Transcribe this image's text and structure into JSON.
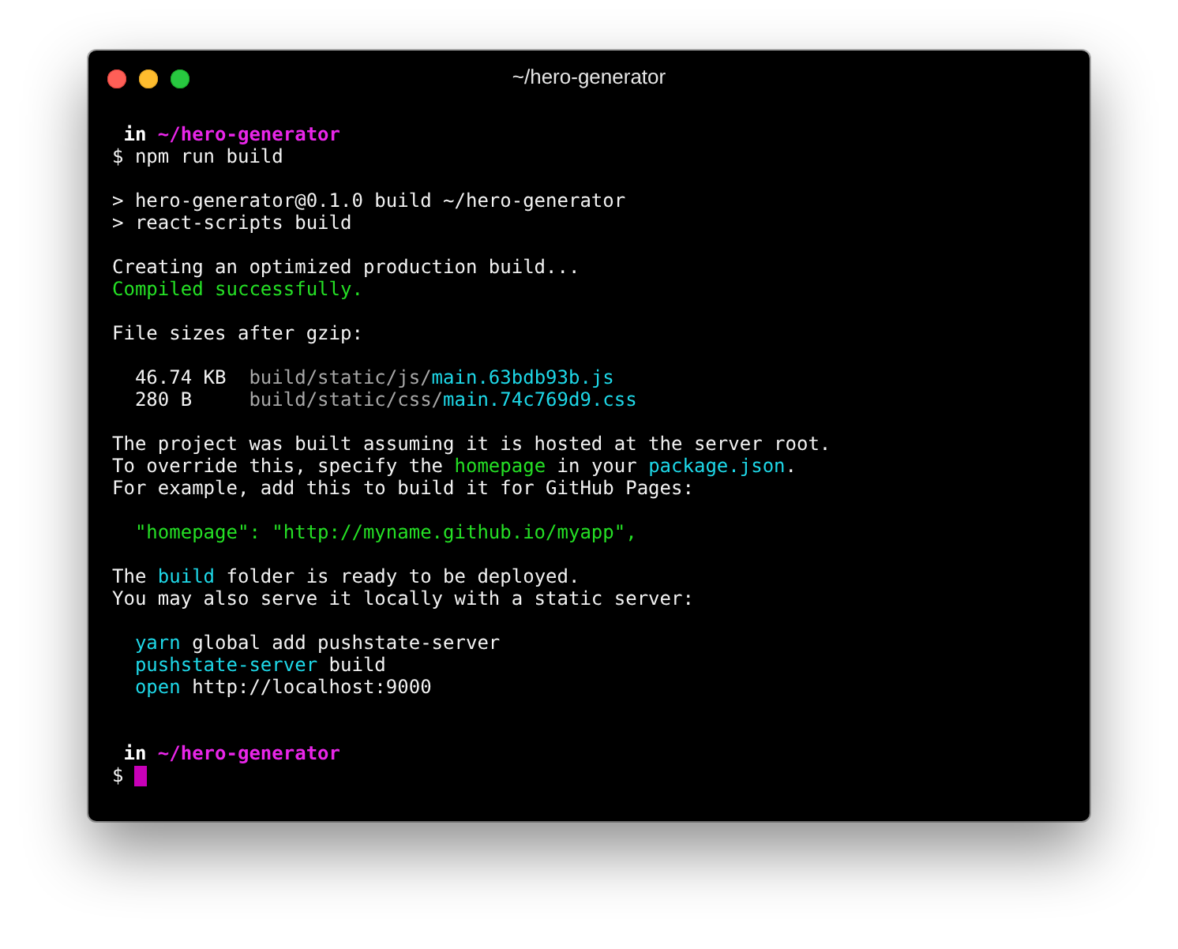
{
  "window": {
    "title": "~/hero-generator"
  },
  "blocks": [
    {
      "kind": "prompt",
      "lines": [
        {
          "segments": [
            {
              "text": " in ",
              "color": "#ffffff"
            },
            {
              "text": "~/hero-generator",
              "color": "#e926e9"
            }
          ]
        },
        {
          "segments": [
            {
              "text": "$ npm run build",
              "color": "#f2f2f2"
            }
          ]
        }
      ]
    },
    {
      "kind": "output",
      "lines": [
        {
          "segments": [
            {
              "text": "> hero-generator@0.1.0 build ~/hero-generator",
              "color": "#f2f2f2"
            }
          ]
        },
        {
          "segments": [
            {
              "text": "> react-scripts build",
              "color": "#f2f2f2"
            }
          ]
        }
      ]
    },
    {
      "kind": "output",
      "lines": [
        {
          "segments": [
            {
              "text": "Creating an optimized production build...",
              "color": "#f2f2f2"
            }
          ]
        },
        {
          "segments": [
            {
              "text": "Compiled successfully.",
              "color": "#25e025"
            }
          ]
        }
      ]
    },
    {
      "kind": "output",
      "lines": [
        {
          "segments": [
            {
              "text": "File sizes after gzip:",
              "color": "#f2f2f2"
            }
          ]
        }
      ]
    },
    {
      "kind": "output",
      "lines": [
        {
          "segments": [
            {
              "text": "  46.74 KB  ",
              "color": "#f2f2f2"
            },
            {
              "text": "build/static/js/",
              "color": "#a8a8a8"
            },
            {
              "text": "main.63bdb93b.js",
              "color": "#1ed8e8"
            }
          ]
        },
        {
          "segments": [
            {
              "text": "  280 B     ",
              "color": "#f2f2f2"
            },
            {
              "text": "build/static/css/",
              "color": "#a8a8a8"
            },
            {
              "text": "main.74c769d9.css",
              "color": "#1ed8e8"
            }
          ]
        }
      ]
    },
    {
      "kind": "output",
      "lines": [
        {
          "segments": [
            {
              "text": "The project was built assuming it is hosted at the server root.",
              "color": "#f2f2f2"
            }
          ]
        },
        {
          "segments": [
            {
              "text": "To override this, specify the ",
              "color": "#f2f2f2"
            },
            {
              "text": "homepage",
              "color": "#25e025"
            },
            {
              "text": " in your ",
              "color": "#f2f2f2"
            },
            {
              "text": "package.json",
              "color": "#1ed8e8"
            },
            {
              "text": ".",
              "color": "#f2f2f2"
            }
          ]
        },
        {
          "segments": [
            {
              "text": "For example, add this to build it for GitHub Pages:",
              "color": "#f2f2f2"
            }
          ]
        }
      ]
    },
    {
      "kind": "output",
      "lines": [
        {
          "segments": [
            {
              "text": "  \"homepage\": \"http://myname.github.io/myapp\",",
              "color": "#25e025"
            }
          ]
        }
      ]
    },
    {
      "kind": "output",
      "lines": [
        {
          "segments": [
            {
              "text": "The ",
              "color": "#f2f2f2"
            },
            {
              "text": "build",
              "color": "#1ed8e8"
            },
            {
              "text": " folder is ready to be deployed.",
              "color": "#f2f2f2"
            }
          ]
        },
        {
          "segments": [
            {
              "text": "You may also serve it locally with a static server:",
              "color": "#f2f2f2"
            }
          ]
        }
      ]
    },
    {
      "kind": "output",
      "lines": [
        {
          "segments": [
            {
              "text": "  yarn",
              "color": "#1ed8e8"
            },
            {
              "text": " global add pushstate-server",
              "color": "#f2f2f2"
            }
          ]
        },
        {
          "segments": [
            {
              "text": "  pushstate-server",
              "color": "#1ed8e8"
            },
            {
              "text": " build",
              "color": "#f2f2f2"
            }
          ]
        },
        {
          "segments": [
            {
              "text": "  open",
              "color": "#1ed8e8"
            },
            {
              "text": " http://localhost:9000",
              "color": "#f2f2f2"
            }
          ]
        }
      ]
    },
    {
      "kind": "prompt",
      "lines": [
        {
          "segments": [
            {
              "text": " in ",
              "color": "#ffffff"
            },
            {
              "text": "~/hero-generator",
              "color": "#e926e9"
            }
          ]
        },
        {
          "segments": [
            {
              "text": "$ ",
              "color": "#f2f2f2"
            }
          ],
          "cursor": true
        }
      ]
    }
  ]
}
